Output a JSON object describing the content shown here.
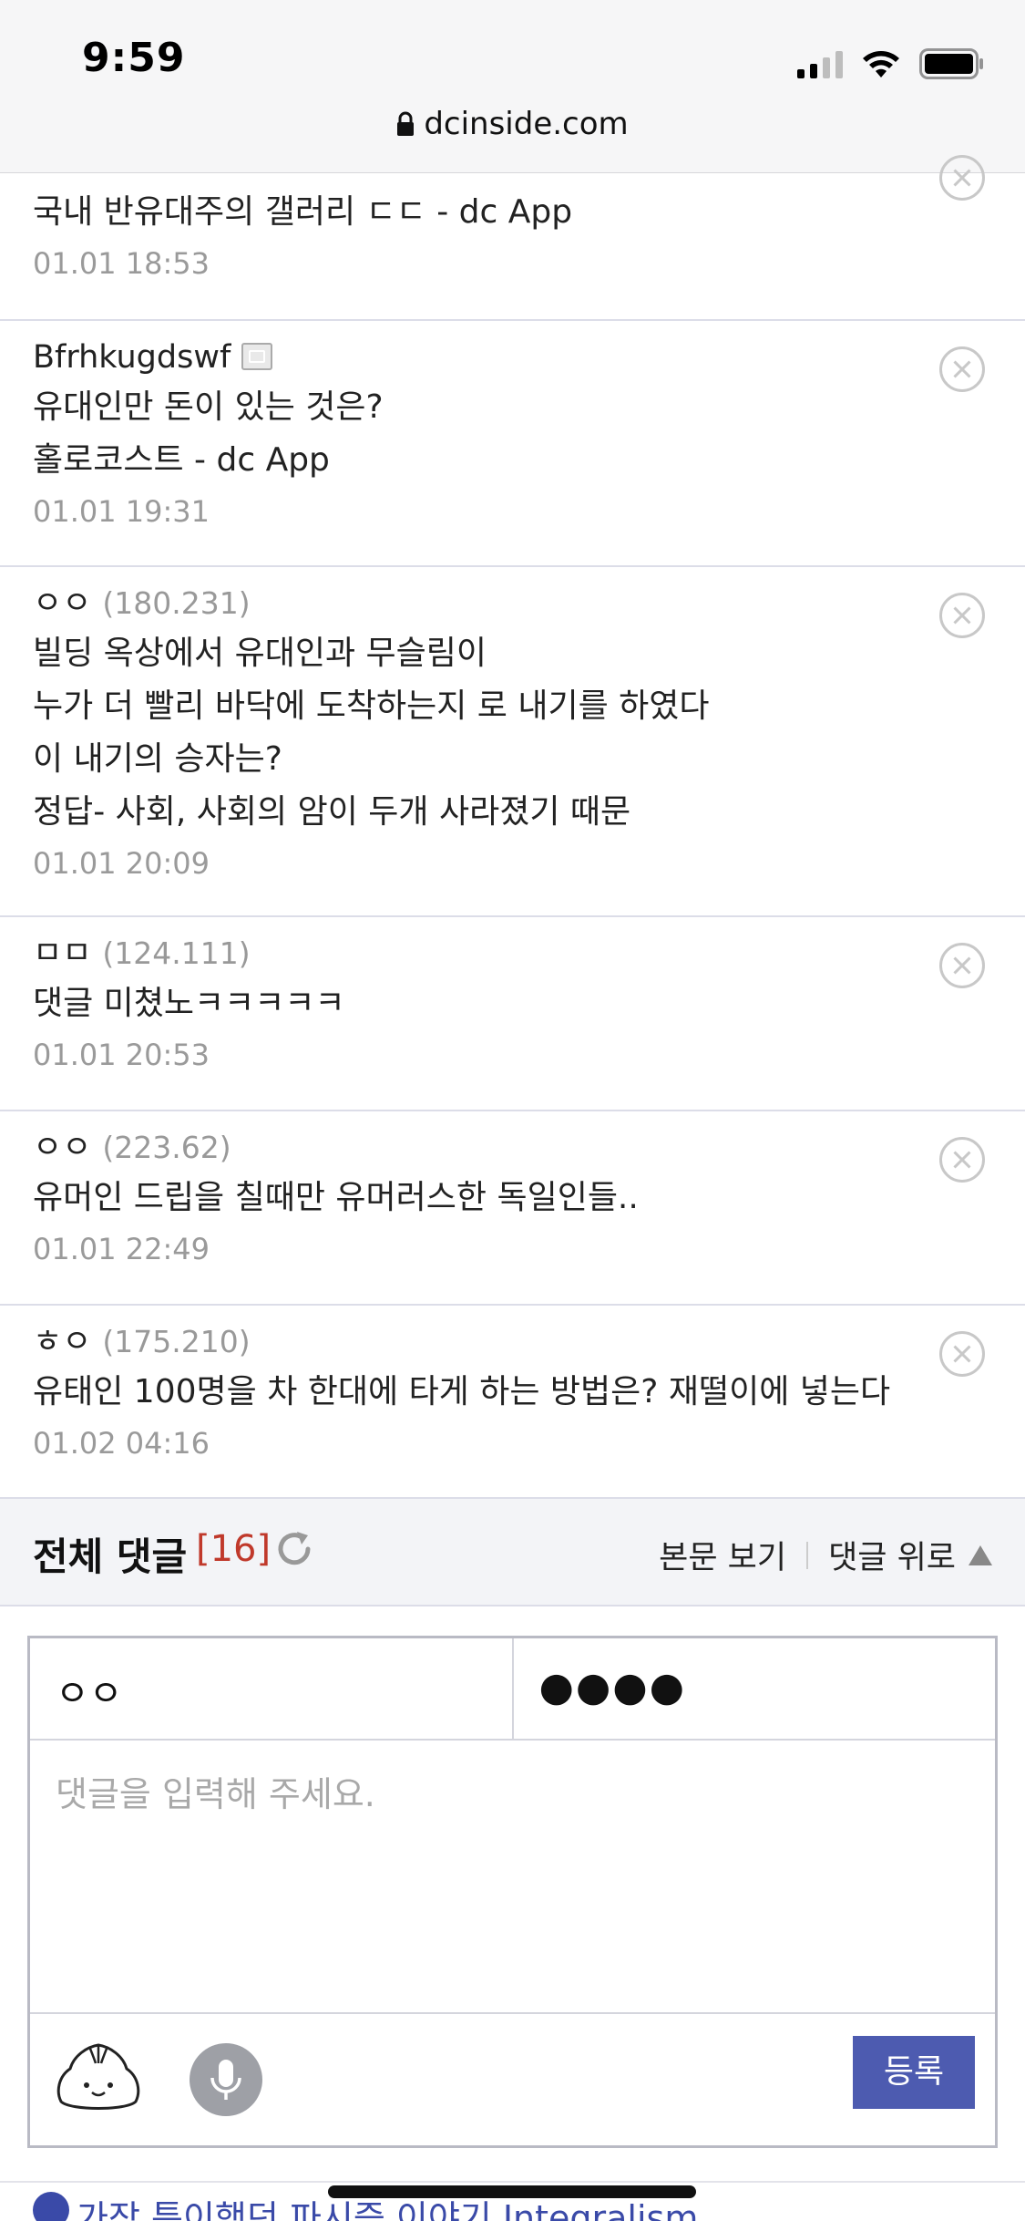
{
  "status": {
    "time": "9:59"
  },
  "browser": {
    "url": "dcinside.com"
  },
  "comments": [
    {
      "name": "",
      "ip": "",
      "lines": [
        "국내 반유대주의 갤러리 ㄷㄷ - dc App"
      ],
      "date": "01.01 18:53"
    },
    {
      "name": "Bfrhkugdswf",
      "ip": "",
      "lines": [
        "유대인만 돈이 있는 것은?",
        "홀로코스트 - dc App"
      ],
      "date": "01.01 19:31"
    },
    {
      "name": "ㅇㅇ",
      "ip": "(180.231)",
      "lines": [
        "빌딩 옥상에서 유대인과 무슬림이",
        "누가 더 빨리 바닥에 도착하는지 로 내기를 하였다",
        "이 내기의 승자는?",
        "정답- 사회, 사회의 암이 두개 사라졌기 때문"
      ],
      "date": "01.01 20:09"
    },
    {
      "name": "ㅁㅁ",
      "ip": "(124.111)",
      "lines": [
        "댓글 미쳤노ㅋㅋㅋㅋㅋ"
      ],
      "date": "01.01 20:53"
    },
    {
      "name": "ㅇㅇ",
      "ip": "(223.62)",
      "lines": [
        "유머인 드립을 칠때만 유머러스한 독일인들.."
      ],
      "date": "01.01 22:49"
    },
    {
      "name": "ㅎㅇ",
      "ip": "(175.210)",
      "lines": [
        "유태인 100명을 차 한대에 타게 하는 방법은? 재떨이에 넣는다"
      ],
      "date": "01.02 04:16"
    }
  ],
  "comment_header": {
    "title": "전체 댓글",
    "count": "[16]",
    "view_post": "본문 보기",
    "to_top": "댓글 위로"
  },
  "form": {
    "nickname": "ㅇㅇ",
    "password": "●●●●",
    "placeholder": "댓글을 입력해 주세요.",
    "submit": "등록"
  },
  "teaser": {
    "text": "가장 특이했던 파시즘 이야기 Integralism"
  },
  "colors": {
    "accent": "#4d5bb0",
    "count": "#c0392b",
    "link": "#3a4aa8"
  }
}
